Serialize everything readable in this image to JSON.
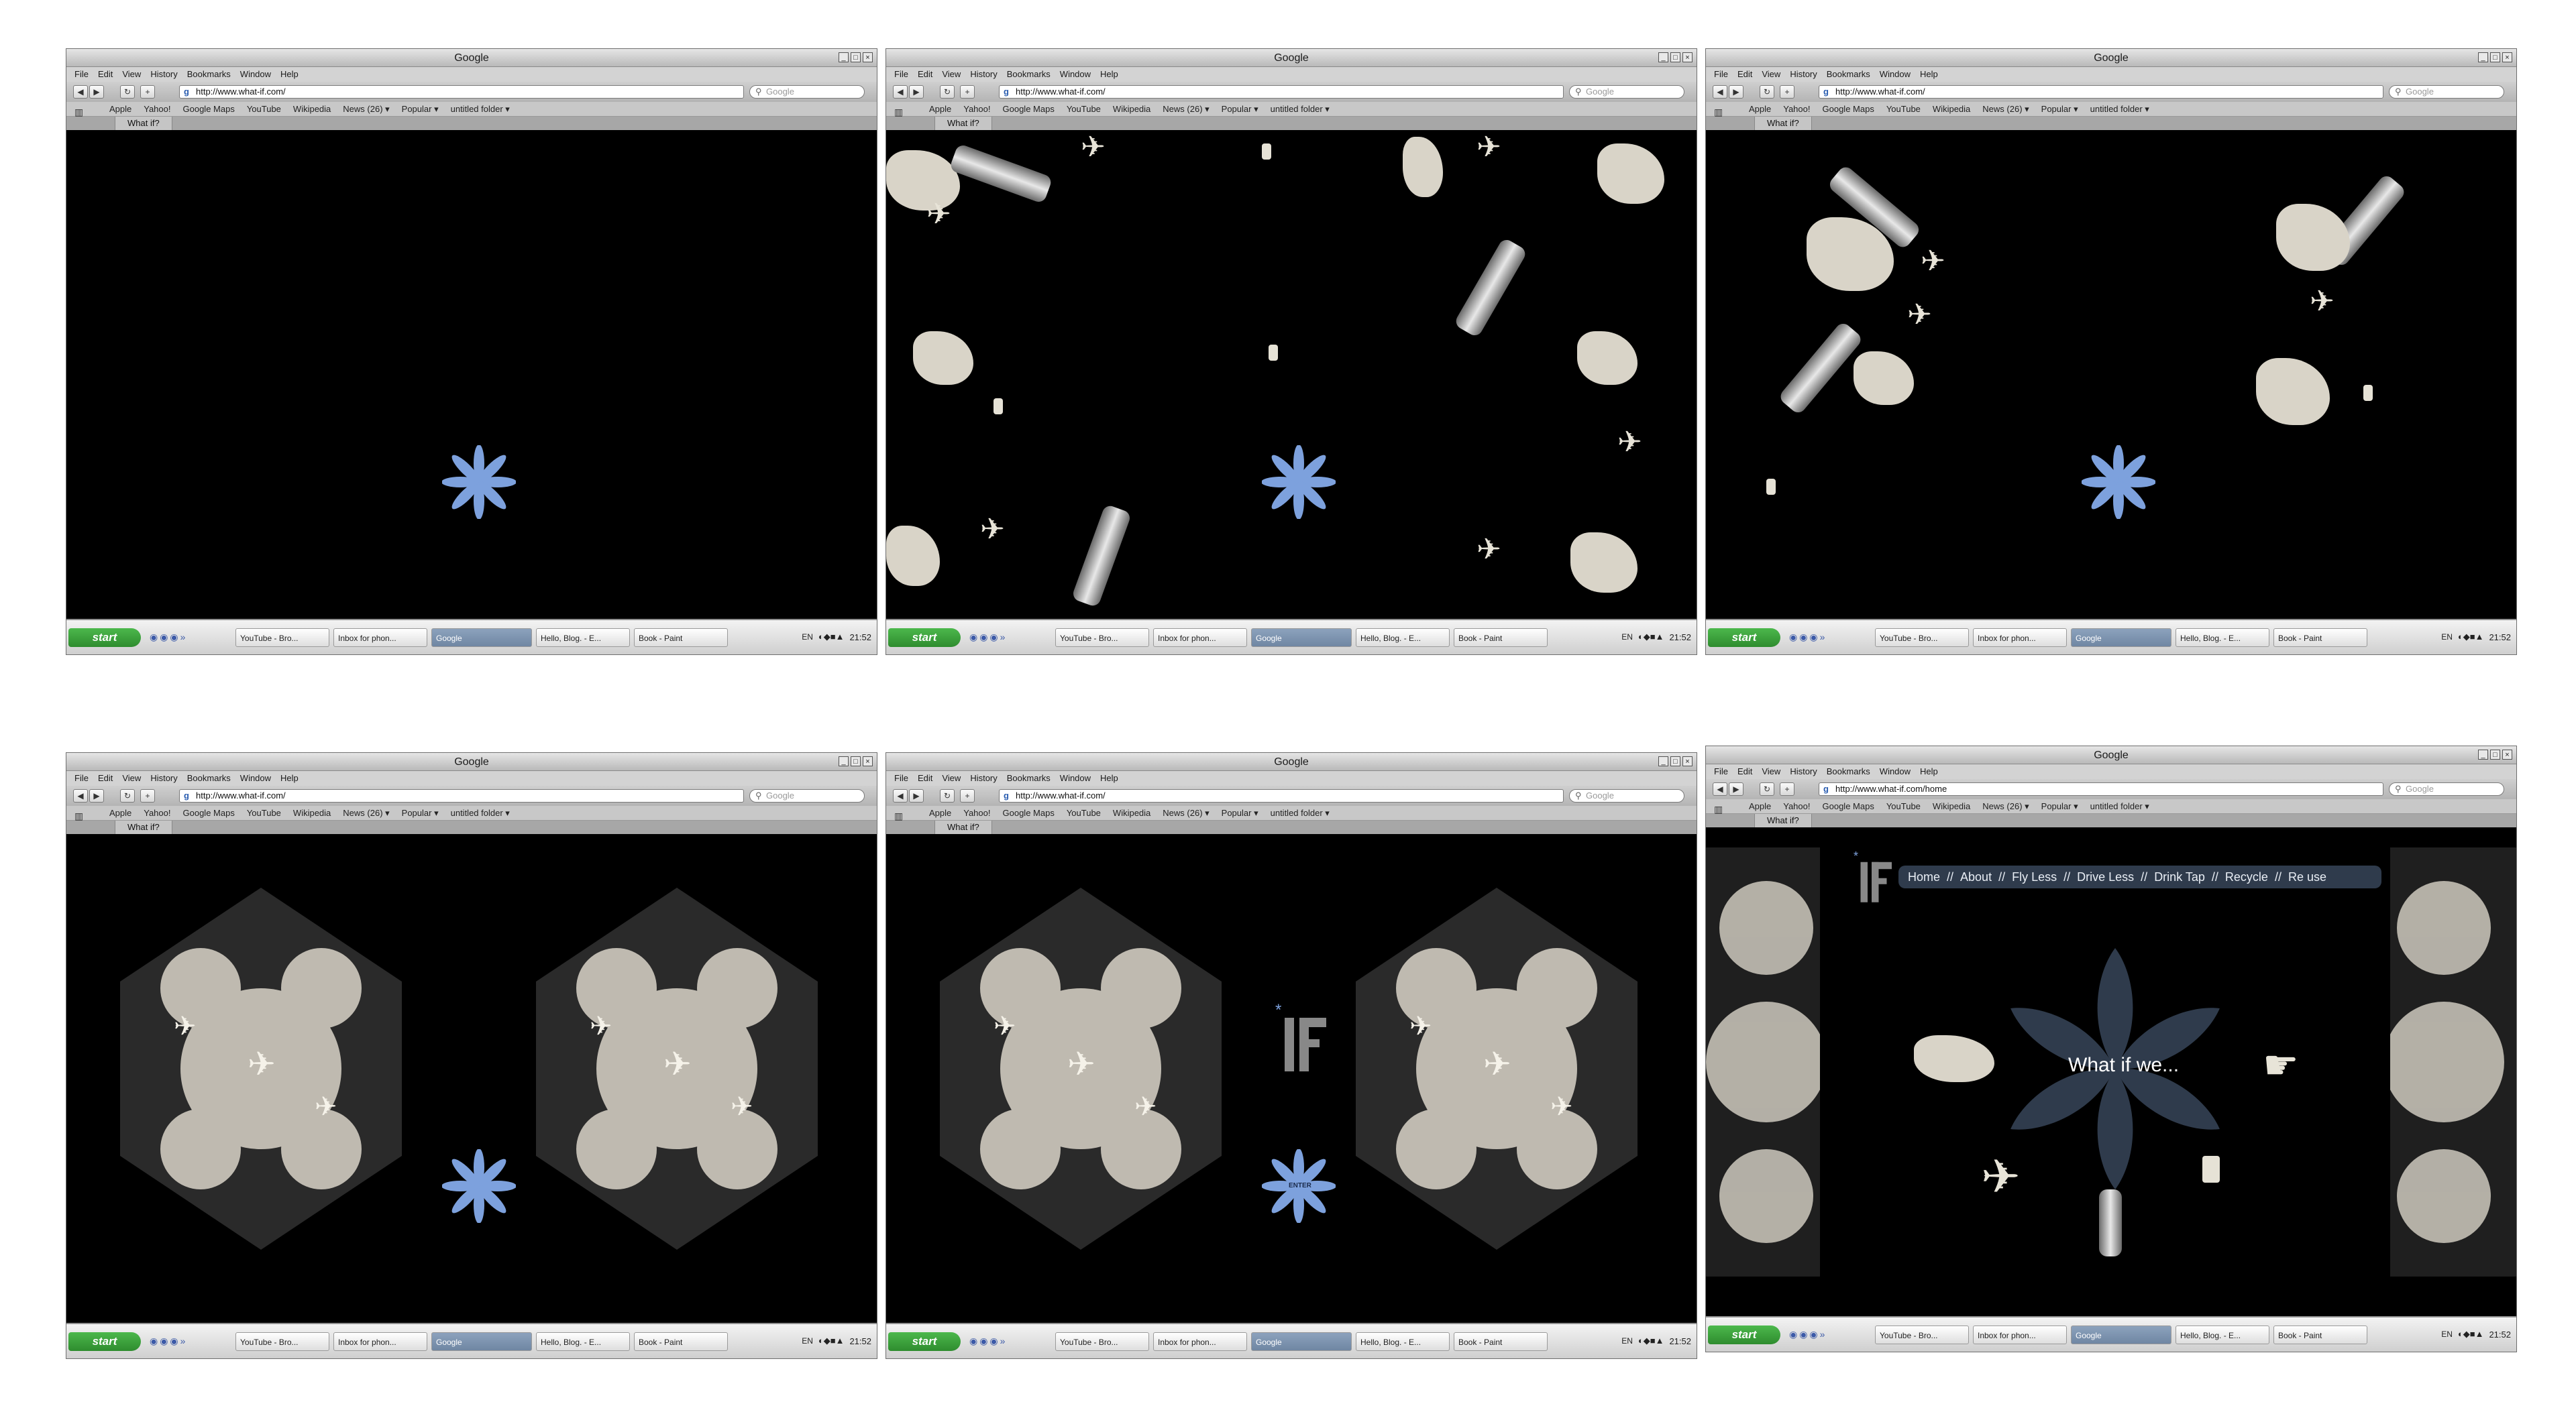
{
  "browser": {
    "window_title": "Google",
    "menu": [
      "File",
      "Edit",
      "View",
      "History",
      "Bookmarks",
      "Window",
      "Help"
    ],
    "search_placeholder": "Google",
    "bookmarks": [
      "Apple",
      "Yahoo!",
      "Google Maps",
      "YouTube",
      "Wikipedia",
      "News (26) ▾",
      "Popular ▾",
      "untitled folder ▾"
    ],
    "tab_label": "What if?"
  },
  "taskbar": {
    "start_label": "start",
    "tasks": [
      "YouTube - Bro...",
      "Inbox for phon...",
      "Google",
      "Hello, Blog. - E...",
      "Book - Paint"
    ],
    "lang": "EN",
    "clock": "21:52"
  },
  "screens": [
    {
      "url": "http://www.what-if.com/",
      "state": "intro-blank"
    },
    {
      "url": "http://www.what-if.com/",
      "state": "scattered-objects"
    },
    {
      "url": "http://www.what-if.com/",
      "state": "clustering-objects"
    },
    {
      "url": "http://www.what-if.com/",
      "state": "kaleidoscope"
    },
    {
      "url": "http://www.what-if.com/",
      "state": "kaleidoscope-logo-enter"
    },
    {
      "url": "http://www.what-if.com/home",
      "state": "home"
    }
  ],
  "enter_label": "ENTER",
  "home": {
    "nav": [
      "Home",
      "//",
      "About",
      "//",
      "Fly Less",
      "//",
      "Drive Less",
      "//",
      "Drink Tap",
      "//",
      "Recycle",
      "//",
      "Re use"
    ],
    "headline": "What if we..."
  },
  "colors": {
    "asterisk_blue": "#7da1dd",
    "asterisk_dark": "#2f3b4c",
    "object_cream": "#d9d4c8"
  }
}
